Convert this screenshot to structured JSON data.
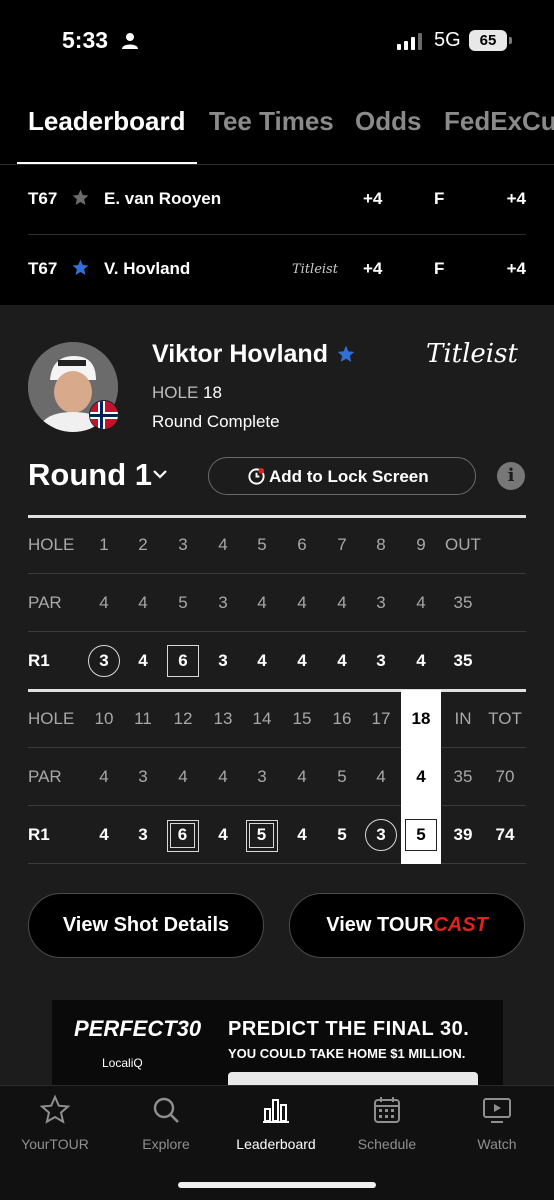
{
  "status_bar": {
    "time": "5:33",
    "network": "5G",
    "battery": "65"
  },
  "tabs": [
    {
      "label": "Leaderboard",
      "active": true
    },
    {
      "label": "Tee Times",
      "active": false
    },
    {
      "label": "Odds",
      "active": false
    },
    {
      "label": "FedExCu",
      "active": false
    }
  ],
  "leaderboard_rows": [
    {
      "pos": "T67",
      "star": "grey",
      "name": "E. van Rooyen",
      "sponsor": "",
      "score": "+4",
      "thru": "F",
      "total": "+4"
    },
    {
      "pos": "T67",
      "star": "blue",
      "name": "V. Hovland",
      "sponsor": "Titleist",
      "score": "+4",
      "thru": "F",
      "total": "+4"
    }
  ],
  "player": {
    "name": "Viktor Hovland",
    "sponsor": "Titleist",
    "hole_label": "HOLE",
    "hole": "18",
    "status": "Round Complete",
    "star_color": "#2f6fd6"
  },
  "round_selector": "Round 1",
  "lock_screen_button": "Add to Lock Screen",
  "info_button": "i",
  "scorecard": {
    "front": {
      "header": {
        "label": "HOLE",
        "cells": [
          "1",
          "2",
          "3",
          "4",
          "5",
          "6",
          "7",
          "8",
          "9",
          "OUT"
        ]
      },
      "par": {
        "label": "PAR",
        "cells": [
          "4",
          "4",
          "5",
          "3",
          "4",
          "4",
          "4",
          "3",
          "4",
          "35"
        ]
      },
      "r1": {
        "label": "R1",
        "cells": [
          "3",
          "4",
          "6",
          "3",
          "4",
          "4",
          "4",
          "3",
          "4",
          "35"
        ],
        "marks": [
          "circle",
          "",
          "square",
          "",
          "",
          "",
          "",
          "",
          "",
          ""
        ]
      }
    },
    "back": {
      "header": {
        "label": "HOLE",
        "cells": [
          "10",
          "11",
          "12",
          "13",
          "14",
          "15",
          "16",
          "17",
          "18",
          "IN",
          "TOT"
        ]
      },
      "par": {
        "label": "PAR",
        "cells": [
          "4",
          "3",
          "4",
          "4",
          "3",
          "4",
          "5",
          "4",
          "4",
          "35",
          "70"
        ]
      },
      "r1": {
        "label": "R1",
        "cells": [
          "4",
          "3",
          "6",
          "4",
          "5",
          "4",
          "5",
          "3",
          "5",
          "39",
          "74"
        ],
        "marks": [
          "",
          "",
          "dsquare",
          "",
          "dsquare",
          "",
          "",
          "circle",
          "square",
          "",
          ""
        ]
      },
      "highlight_hole": "18"
    }
  },
  "buttons": {
    "shot_details": "View Shot Details",
    "tourcast_prefix": "View TOUR",
    "tourcast_suffix": "CAST"
  },
  "ad": {
    "logo": "PERFECT30",
    "presented_by": "PRESENTED BY",
    "sponsor": "LocaliQ",
    "headline": "PREDICT THE FINAL 30.",
    "subhead": "YOU COULD TAKE HOME $1 MILLION."
  },
  "bottom_nav": [
    {
      "label": "YourTOUR",
      "icon": "star-icon",
      "active": false
    },
    {
      "label": "Explore",
      "icon": "search-icon",
      "active": false
    },
    {
      "label": "Leaderboard",
      "icon": "bar-chart-icon",
      "active": true
    },
    {
      "label": "Schedule",
      "icon": "calendar-icon",
      "active": false
    },
    {
      "label": "Watch",
      "icon": "tv-play-icon",
      "active": false
    }
  ],
  "colors": {
    "accent_red": "#e2231a",
    "star_blue": "#2f6fd6",
    "card_bg": "#1c1c1c"
  }
}
